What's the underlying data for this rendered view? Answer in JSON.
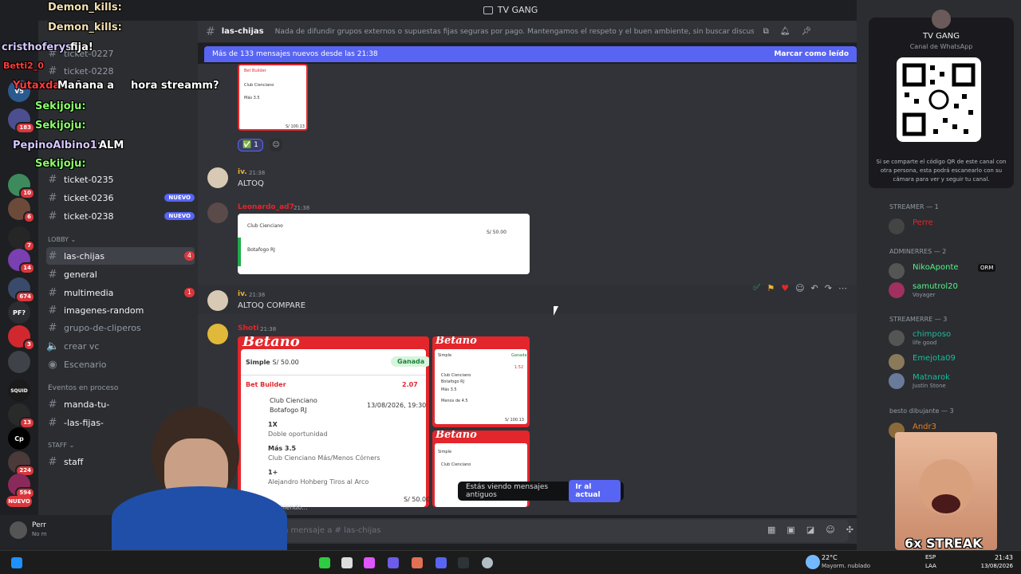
{
  "app": {
    "title": "TV GANG"
  },
  "overlay_chat": [
    {
      "user": "Demon_kills:",
      "text": ""
    },
    {
      "user": "Demon_kills:",
      "text": ""
    },
    {
      "user": "cristhoferys:",
      "text": "fija!"
    },
    {
      "user": "Betti2_0",
      "text": ""
    },
    {
      "user": "Yutaxdan:",
      "text": "Mañana a",
      "text2": "hora streamm?"
    },
    {
      "user": "Sekijoju:",
      "text": ""
    },
    {
      "user": "Sekijoju:",
      "text": ""
    },
    {
      "user": "PepinoAlbino1:",
      "text": "ALM"
    },
    {
      "user": "Sekijoju:",
      "text": ""
    }
  ],
  "servers": [
    {
      "label": "V5",
      "badge": ""
    },
    {
      "label": "",
      "badge": "183"
    },
    {
      "label": "",
      "badge": "10"
    },
    {
      "label": "",
      "badge": "6"
    },
    {
      "label": "",
      "badge": "7"
    },
    {
      "label": "",
      "badge": "14"
    },
    {
      "label": "",
      "badge": "674"
    },
    {
      "label": "PF?",
      "badge": ""
    },
    {
      "label": "",
      "badge": "3"
    },
    {
      "label": "",
      "badge": ""
    },
    {
      "label": "SQUID",
      "badge": ""
    },
    {
      "label": "",
      "badge": "13"
    },
    {
      "label": "Cp",
      "badge": ""
    },
    {
      "label": "",
      "badge": "224"
    },
    {
      "label": "",
      "badge": "594"
    },
    {
      "label": "NUEVO",
      "badge": ""
    }
  ],
  "channels": {
    "tickets_top": [
      "ticket-0227",
      "ticket-0228"
    ],
    "tickets": [
      {
        "name": "ticket-0235",
        "tag": ""
      },
      {
        "name": "ticket-0236",
        "tag": "NUEVO"
      },
      {
        "name": "ticket-0238",
        "tag": "NUEVO"
      }
    ],
    "lobby_label": "LOBBY",
    "lobby": [
      {
        "name": "las-chijas",
        "count": "4"
      },
      {
        "name": "general",
        "count": ""
      },
      {
        "name": "multimedia",
        "count": "1"
      },
      {
        "name": "imagenes-random",
        "count": ""
      },
      {
        "name": "grupo-de-cliperos",
        "count": ""
      },
      {
        "name": "crear vc",
        "count": ""
      },
      {
        "name": "Escenario",
        "count": ""
      }
    ],
    "events_label": "Eventos en proceso",
    "events": [
      "manda-tu-",
      "-las-fijas-"
    ],
    "staff_label": "STAFF",
    "staff": [
      "staff"
    ]
  },
  "header": {
    "channel": "las-chijas",
    "topic": "Nada de difundir grupos externos o supuestas fijas seguras por pago. Mantengamos el respeto y el buen ambiente, sin buscar discusiones ni generar odi..."
  },
  "new_messages": {
    "text": "Más de 133 mensajes nuevos desde las 21:38",
    "action": "Marcar como leído"
  },
  "messages": [
    {
      "user": "iv.",
      "time": "21:38",
      "text": "ALTOQ",
      "color": "#f0b232"
    },
    {
      "user": "Leonardo_ad7",
      "time": "21:38",
      "text": "",
      "color": "#e3262b"
    },
    {
      "user": "iv.",
      "time": "21:38",
      "text": "ALTOQ COMPARE",
      "color": "#f0b232"
    },
    {
      "user": "Shoti",
      "time": "21:38",
      "text": "",
      "color": "#e3262b"
    }
  ],
  "reaction": {
    "emoji": "✅",
    "count": "1"
  },
  "bet_card": {
    "brand": "Betano",
    "type": "Simple",
    "stake": "S/ 50.00",
    "status": "Ganada",
    "builder": "Bet Builder",
    "odds": "2.07",
    "team1": "Club Cienciano",
    "team2": "Botafogo RJ",
    "date": "13/08/2026, 19:30",
    "sel1": "1X",
    "sel1_desc": "Doble oportunidad",
    "sel2": "Más 3.5",
    "sel2_desc": "Club Cienciano Más/Menos Córners",
    "sel3": "1+",
    "sel3_desc": "Alejandro Hohberg Tiros al Arco",
    "amount": "S/ 50.00"
  },
  "side_card": {
    "brand": "Betano",
    "type": "Simple",
    "badge": "Ganada",
    "odds": "1.52",
    "team1": "Club Cienciano",
    "team2": "Botafogo RJ",
    "sel1": "Más 3.5",
    "sel2": "Menos de 4.5",
    "amount": "S/ 100.13"
  },
  "typing": "escribiendo...",
  "old_messages": {
    "text": "Estás viendo mensajes antiguos",
    "button": "Ir al actual"
  },
  "composer": {
    "placeholder": "las-chijas"
  },
  "whatsapp": {
    "title": "TV GANG",
    "subtitle": "Canal de WhatsApp",
    "note": "Si se comparte el código QR de este canal con otra persona, esta podrá escanearlo con su cámara para ver y seguir tu canal."
  },
  "members": {
    "groups": [
      {
        "label": "STREAMER — 1",
        "items": [
          {
            "name": "Perre",
            "sub": "",
            "color": "#e3262b"
          }
        ]
      },
      {
        "label": "ADMINERRES — 2",
        "items": [
          {
            "name": "NikoAponte",
            "sub": "",
            "color": "#57f287",
            "tag": "ORM"
          },
          {
            "name": "samutrol20",
            "sub": "Voyager",
            "color": "#57f287"
          }
        ]
      },
      {
        "label": "STREAMERRE — 3",
        "items": [
          {
            "name": "chimposo",
            "sub": "life good",
            "color": "#1abc9c"
          },
          {
            "name": "Emejota09",
            "sub": "",
            "color": "#1abc9c"
          },
          {
            "name": "Matnarok",
            "sub": "Justin Stone",
            "color": "#1abc9c"
          }
        ]
      },
      {
        "label": "besto dibujante — 3",
        "items": [
          {
            "name": "Andr3",
            "sub": "",
            "color": "#e67e22"
          }
        ]
      }
    ]
  },
  "webcam_badge": "6x STREAK",
  "user_panel": {
    "name": "Perr",
    "status": "No m"
  },
  "taskbar": {
    "weather_temp": "22°C",
    "weather_desc": "Mayorm. nublado",
    "lang": "ESP",
    "lang2": "LAA",
    "time": "21:43",
    "date": "13/08/2026"
  },
  "colors": {
    "accent": "#5865f2",
    "betano": "#e3262b",
    "bg": "#313338"
  }
}
